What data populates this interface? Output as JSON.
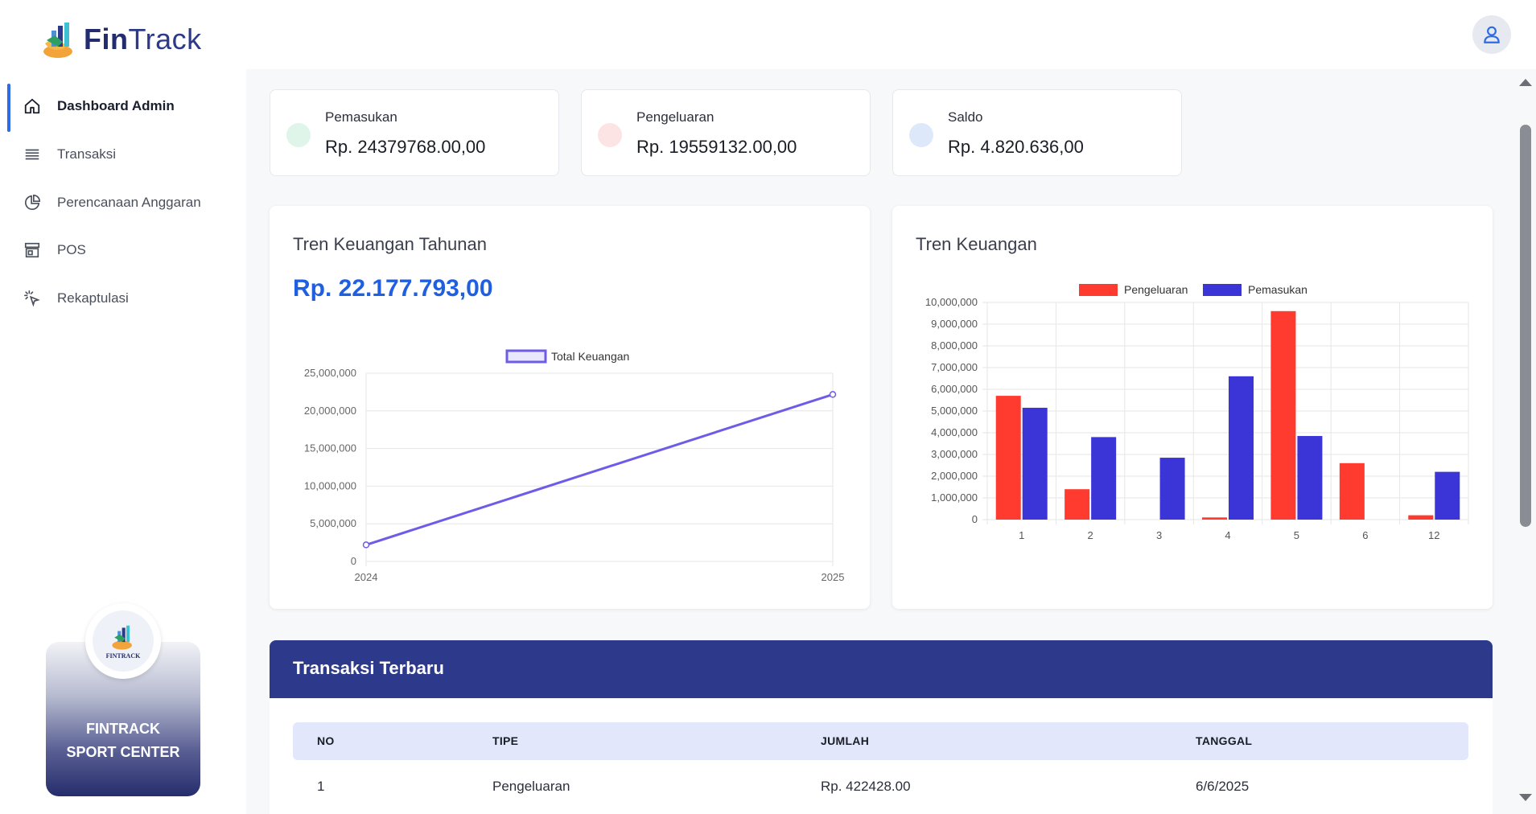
{
  "app": {
    "logo_fin": "Fin",
    "logo_track": "Track"
  },
  "colors": {
    "accent": "#2e6be6",
    "brand": "#2d3a8c",
    "income": "#3b35d8",
    "expense": "#ff3a2e",
    "total_line": "#6c5ce7",
    "income_dot": "#dff5ea",
    "expense_dot": "#fde4e4",
    "saldo_dot": "#dde9fb"
  },
  "sidebar": {
    "items": [
      {
        "label": "Dashboard Admin",
        "icon": "home-icon",
        "active": true
      },
      {
        "label": "Transaksi",
        "icon": "list-icon",
        "active": false
      },
      {
        "label": "Perencanaan Anggaran",
        "icon": "pie-chart-icon",
        "active": false
      },
      {
        "label": "POS",
        "icon": "store-icon",
        "active": false
      },
      {
        "label": "Rekaptulasi",
        "icon": "cursor-click-icon",
        "active": false
      }
    ],
    "brand_card": {
      "logo_text": "FINTRACK",
      "name_line1": "FINTRACK",
      "name_line2": "SPORT CENTER"
    }
  },
  "summary": {
    "income": {
      "label": "Pemasukan",
      "value": "Rp. 24379768.00,00"
    },
    "expense": {
      "label": "Pengeluaran",
      "value": "Rp. 19559132.00,00"
    },
    "balance": {
      "label": "Saldo",
      "value": "Rp. 4.820.636,00"
    }
  },
  "yearly": {
    "title": "Tren Keuangan Tahunan",
    "total": "Rp. 22.177.793,00"
  },
  "monthly": {
    "title": "Tren Keuangan"
  },
  "chart_data": [
    {
      "type": "line",
      "title": "",
      "x": [
        "2024",
        "2025"
      ],
      "series": [
        {
          "name": "Total Keuangan",
          "values": [
            2200000,
            22177793
          ]
        }
      ],
      "ylim": [
        0,
        25000000
      ],
      "yticks": [
        "0",
        "5,000,000",
        "10,000,000",
        "15,000,000",
        "20,000,000",
        "25,000,000"
      ],
      "grid": true,
      "legend": "top-center"
    },
    {
      "type": "bar",
      "title": "",
      "categories": [
        "1",
        "2",
        "3",
        "4",
        "5",
        "6",
        "12"
      ],
      "series": [
        {
          "name": "Pengeluaran",
          "values": [
            5700000,
            1400000,
            0,
            100000,
            9600000,
            2600000,
            200000
          ]
        },
        {
          "name": "Pemasukan",
          "values": [
            5150000,
            3800000,
            2850000,
            6600000,
            3850000,
            0,
            2200000
          ]
        }
      ],
      "ylim": [
        0,
        10000000
      ],
      "yticks": [
        "0",
        "1,000,000",
        "2,000,000",
        "3,000,000",
        "4,000,000",
        "5,000,000",
        "6,000,000",
        "7,000,000",
        "8,000,000",
        "9,000,000",
        "10,000,000"
      ],
      "grid": true,
      "legend": "top-center"
    }
  ],
  "table": {
    "title": "Transaksi Terbaru",
    "headers": [
      "NO",
      "TIPE",
      "JUMLAH",
      "TANGGAL"
    ],
    "rows": [
      [
        "1",
        "Pengeluaran",
        "Rp. 422428.00",
        "6/6/2025"
      ]
    ]
  }
}
